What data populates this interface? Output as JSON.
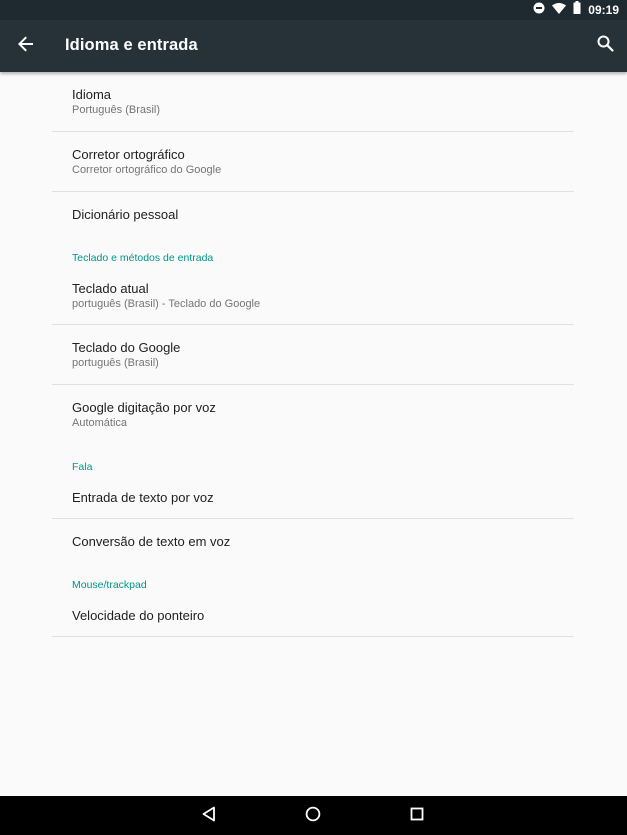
{
  "status_bar": {
    "time": "09:19",
    "icons": [
      "do-not-disturb-icon",
      "wifi-icon",
      "battery-icon"
    ]
  },
  "app_bar": {
    "title": "Idioma e entrada",
    "back_icon": "arrow-back-icon",
    "search_icon": "search-icon"
  },
  "items": {
    "idioma": {
      "title": "Idioma",
      "summary": "Português (Brasil)"
    },
    "corretor": {
      "title": "Corretor ortográfico",
      "summary": "Corretor ortográfico do Google"
    },
    "dicionario": {
      "title": "Dicionário pessoal"
    },
    "teclado_atual": {
      "title": "Teclado atual",
      "summary": "português (Brasil) - Teclado do Google"
    },
    "teclado_google": {
      "title": "Teclado do Google",
      "summary": "português (Brasil)"
    },
    "voz": {
      "title": "Google digitação por voz",
      "summary": "Automática"
    },
    "entrada_voz": {
      "title": "Entrada de texto por voz"
    },
    "conversao": {
      "title": "Conversão de texto em voz"
    },
    "velocidade": {
      "title": "Velocidade do ponteiro"
    }
  },
  "categories": {
    "teclado": "Teclado e métodos de entrada",
    "fala": "Fala",
    "mouse": "Mouse/trackpad"
  },
  "nav_bar": {
    "icons": [
      "back-triangle-icon",
      "home-circle-icon",
      "recents-square-icon"
    ]
  },
  "colors": {
    "status_bar": "#1f2a30",
    "app_bar": "#263238",
    "accent": "#009688",
    "background": "#fafafa",
    "nav_bar": "#000000"
  }
}
